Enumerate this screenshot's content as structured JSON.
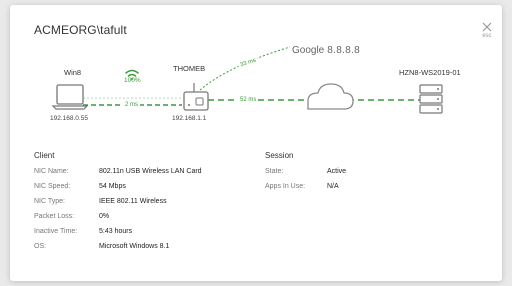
{
  "dialog": {
    "title": "ACMEORG\\tafult",
    "close_hint": "esc"
  },
  "topology": {
    "client": {
      "name": "Win8",
      "ip": "192.168.0.55",
      "signal_pct": "100%",
      "icon": "laptop-icon"
    },
    "access_point": {
      "name": "THOMEB",
      "ip": "192.168.1.1",
      "icon": "router-icon"
    },
    "internet": {
      "brand": "Google",
      "address": "8.8.8.8",
      "icon": "cloud-icon"
    },
    "server": {
      "name": "HZN8-WS2019-01",
      "icon": "server-icon"
    },
    "links": {
      "client_to_ap": "2 ms",
      "ap_to_google": "33 ms",
      "ap_to_server": "52 ms"
    },
    "colors": {
      "link": "#3a9b3a",
      "device": "#8a8a8a"
    }
  },
  "client": {
    "heading": "Client",
    "rows": [
      {
        "label": "NIC Name:",
        "value": "802.11n USB Wireless LAN Card"
      },
      {
        "label": "NIC Speed:",
        "value": "54 Mbps"
      },
      {
        "label": "NIC Type:",
        "value": "IEEE 802.11 Wireless"
      },
      {
        "label": "Packet Loss:",
        "value": "0%"
      },
      {
        "label": "Inactive Time:",
        "value": "5:43 hours"
      },
      {
        "label": "OS:",
        "value": "Microsoft Windows 8.1"
      }
    ]
  },
  "session": {
    "heading": "Session",
    "rows": [
      {
        "label": "State:",
        "value": "Active"
      },
      {
        "label": "Apps In Use:",
        "value": "N/A"
      }
    ]
  }
}
